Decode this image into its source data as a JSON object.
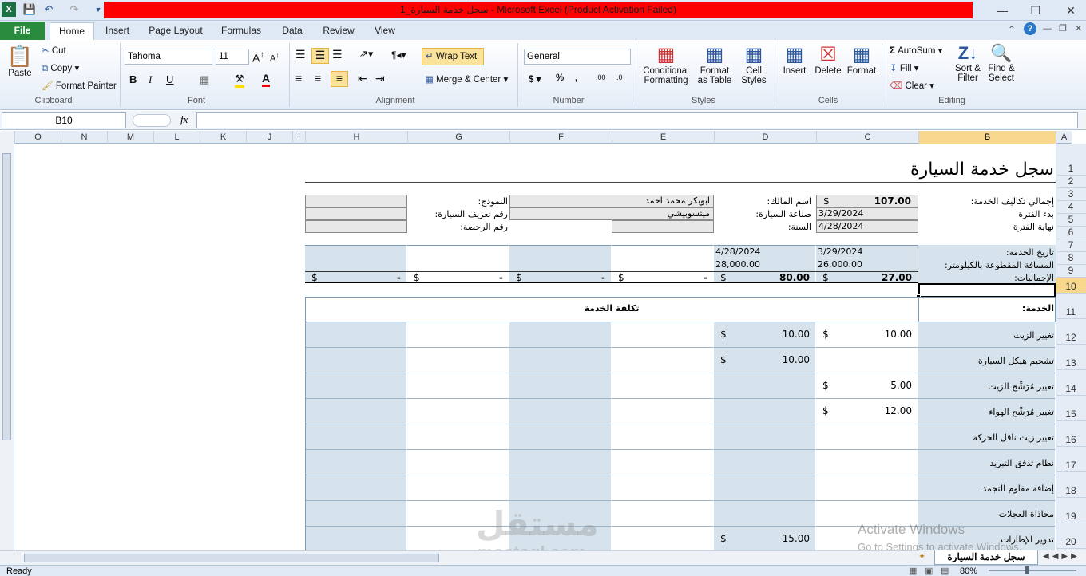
{
  "window": {
    "title": "سجل خدمة السيارة_1  -  Microsoft Excel (Product Activation Failed)"
  },
  "tabs": {
    "file": "File",
    "home": "Home",
    "insert": "Insert",
    "page_layout": "Page Layout",
    "formulas": "Formulas",
    "data": "Data",
    "review": "Review",
    "view": "View"
  },
  "ribbon": {
    "clipboard": {
      "paste": "Paste",
      "cut": "Cut",
      "copy": "Copy",
      "format_painter": "Format Painter",
      "label": "Clipboard"
    },
    "font": {
      "name": "Tahoma",
      "size": "11",
      "label": "Font"
    },
    "alignment": {
      "wrap_text": "Wrap Text",
      "merge_center": "Merge & Center",
      "label": "Alignment"
    },
    "number": {
      "format": "General",
      "label": "Number"
    },
    "styles": {
      "conditional": "Conditional",
      "formatting": "Formatting",
      "format": "Format",
      "as_table": "as Table",
      "cell": "Cell",
      "styles": "Styles",
      "label": "Styles"
    },
    "cells": {
      "insert": "Insert",
      "delete": "Delete",
      "format": "Format",
      "label": "Cells"
    },
    "editing": {
      "autosum": "AutoSum",
      "fill": "Fill",
      "clear": "Clear",
      "sort": "Sort &",
      "filter": "Filter",
      "find": "Find &",
      "select": "Select",
      "label": "Editing"
    }
  },
  "formula_bar": {
    "name_box": "B10",
    "fx": "fx",
    "value": ""
  },
  "columns": [
    "A",
    "B",
    "C",
    "D",
    "E",
    "F",
    "G",
    "H",
    "I",
    "J",
    "K",
    "L",
    "M",
    "N",
    "O"
  ],
  "rows": [
    "1",
    "2",
    "3",
    "4",
    "5",
    "6",
    "7",
    "8",
    "9",
    "10",
    "11",
    "12",
    "13",
    "14",
    "15",
    "16",
    "17",
    "18",
    "19",
    "20"
  ],
  "sheet": {
    "title": "سجل خدمة السيارة",
    "total_cost_label": "إجمالي تكاليف الخدمة:",
    "total_cost_currency": "$",
    "total_cost_value": "107.00",
    "period_start_label": "بدء الفترة",
    "period_start_value": "3/29/2024",
    "period_end_label": "نهاية الفترة",
    "period_end_value": "4/28/2024",
    "owner_label": "اسم المالك:",
    "owner_value": "ابوبكر محمد احمد",
    "make_label": "صناعة السيارة:",
    "make_value": "ميتسوبيشي",
    "year_label": "السنة:",
    "model_label": "النموذج:",
    "vin_label": "رقم تعريف السيارة:",
    "plate_label": "رقم الرخصة:",
    "service_date_label": "تاريخ الخدمة:",
    "mileage_label": "المسافة المقطوعة بالكيلومتر:",
    "totals_label": "الإجماليات:",
    "dates": [
      "3/29/2024",
      "4/28/2024"
    ],
    "mileages": [
      "26,000.00",
      "28,000.00"
    ],
    "totals": [
      "27.00",
      "80.00",
      "-",
      "-",
      "-",
      "-"
    ],
    "currency": "$",
    "service_header": "الخدمة:",
    "cost_header": "تكلفة الخدمة",
    "services": [
      {
        "name": "تغيير الزيت",
        "c": "10.00",
        "d": "10.00"
      },
      {
        "name": "تشحيم هيكل السيارة",
        "c": "",
        "d": "10.00"
      },
      {
        "name": "تغيير مُرَشِّح الزيت",
        "c": "5.00",
        "d": ""
      },
      {
        "name": "تغيير مُرَشِّح الهواء",
        "c": "12.00",
        "d": ""
      },
      {
        "name": "تغيير زيت ناقل الحركة",
        "c": "",
        "d": ""
      },
      {
        "name": "نظام تدفق التبريد",
        "c": "",
        "d": ""
      },
      {
        "name": "إضافة مقاوم التجمد",
        "c": "",
        "d": ""
      },
      {
        "name": "محاذاة العجلات",
        "c": "",
        "d": ""
      },
      {
        "name": "تدوير الإطارات",
        "c": "",
        "d": "15.00"
      }
    ]
  },
  "watermark": {
    "activate": "Activate Windows",
    "goto": "Go to Settings to activate Windows.",
    "brand_ar": "مستقل",
    "brand_en": "mostaql.com"
  },
  "status": {
    "ready": "Ready",
    "zoom": "80%",
    "sheet_tab": "سجل خدمة السيارة"
  }
}
